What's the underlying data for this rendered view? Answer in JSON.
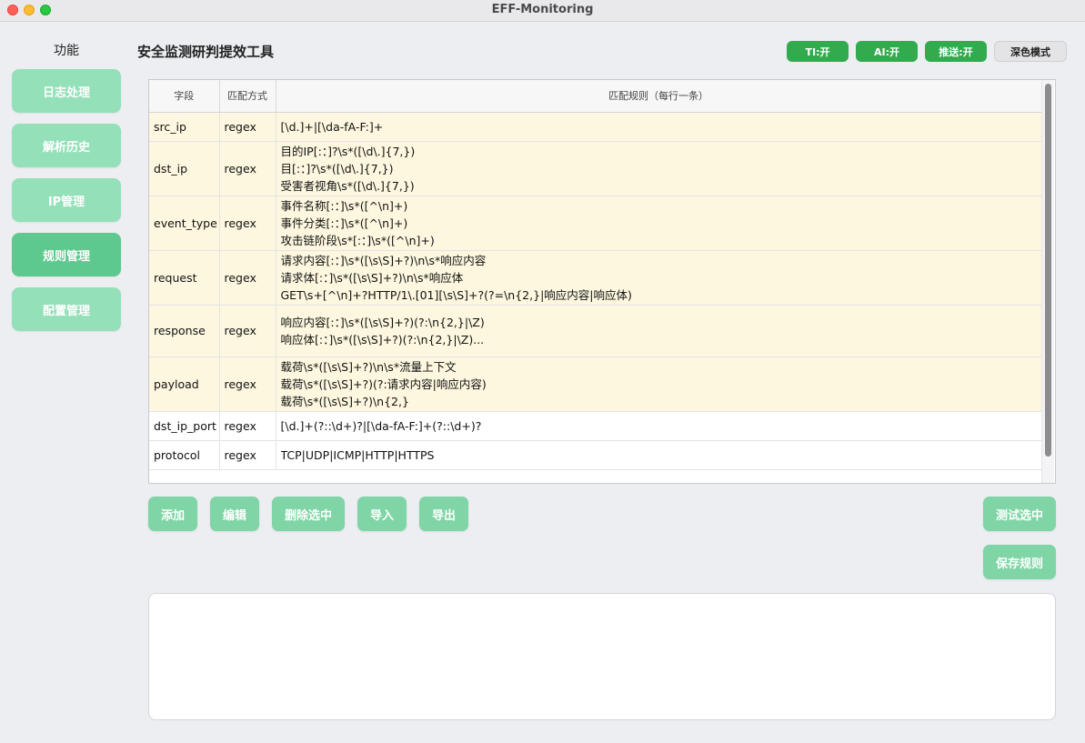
{
  "window": {
    "title": "EFF-Monitoring"
  },
  "sidebar": {
    "heading": "功能",
    "items": [
      {
        "label": "日志处理"
      },
      {
        "label": "解析历史"
      },
      {
        "label": "IP管理"
      },
      {
        "label": "规则管理"
      },
      {
        "label": "配置管理"
      }
    ]
  },
  "header": {
    "title": "安全监测研判提效工具",
    "toggles": {
      "ti": "TI:开",
      "ai": "AI:开",
      "push": "推送:开",
      "dark": "深色模式"
    }
  },
  "table": {
    "columns": [
      "字段",
      "匹配方式",
      "匹配规则（每行一条）"
    ],
    "rows": [
      {
        "field": "src_ip",
        "method": "regex",
        "rules": [
          "[\\d.]+|[\\da-fA-F:]+"
        ]
      },
      {
        "field": "dst_ip",
        "method": "regex",
        "rules": [
          "目的IP[:：]?\\s*([\\d\\.]{7,})",
          "目[:：]?\\s*([\\d\\.]{7,})",
          "受害者视角\\s*([\\d\\.]{7,})"
        ]
      },
      {
        "field": "event_type",
        "method": "regex",
        "rules": [
          "事件名称[:：]\\s*([^\\n]+)",
          "事件分类[:：]\\s*([^\\n]+)",
          "攻击链阶段\\s*[:：]\\s*([^\\n]+)"
        ]
      },
      {
        "field": "request",
        "method": "regex",
        "rules": [
          "请求内容[:：]\\s*([\\s\\S]+?)\\n\\s*响应内容",
          "请求体[:：]\\s*([\\s\\S]+?)\\n\\s*响应体",
          "GET\\s+[^\\n]+?HTTP/1\\.[01][\\s\\S]+?(?=\\n{2,}|响应内容|响应体)"
        ]
      },
      {
        "field": "response",
        "method": "regex",
        "rules": [
          "响应内容[:：]\\s*([\\s\\S]+?)(?:\\n{2,}|\\Z)",
          "响应体[:：]\\s*([\\s\\S]+?)(?:\\n{2,}|\\Z)..."
        ]
      },
      {
        "field": "payload",
        "method": "regex",
        "rules": [
          "载荷\\s*([\\s\\S]+?)\\n\\s*流量上下文",
          "载荷\\s*([\\s\\S]+?)(?:请求内容|响应内容)",
          "载荷\\s*([\\s\\S]+?)\\n{2,}"
        ]
      },
      {
        "field": "dst_ip_port",
        "method": "regex",
        "rules": [
          "[\\d.]+(?::\\d+)?|[\\da-fA-F:]+(?::\\d+)?"
        ]
      },
      {
        "field": "protocol",
        "method": "regex",
        "rules": [
          "TCP|UDP|ICMP|HTTP|HTTPS"
        ]
      }
    ]
  },
  "actions": {
    "add": "添加",
    "edit": "编辑",
    "delete": "删除选中",
    "import": "导入",
    "export": "导出",
    "test": "测试选中",
    "save": "保存规则"
  },
  "colors": {
    "nav_button": "#94e0b9",
    "nav_button_active": "#5ec98f",
    "toggle_on": "#32ab4f",
    "action_button": "#7fd5a5",
    "row_highlight": "#fdf7df"
  }
}
